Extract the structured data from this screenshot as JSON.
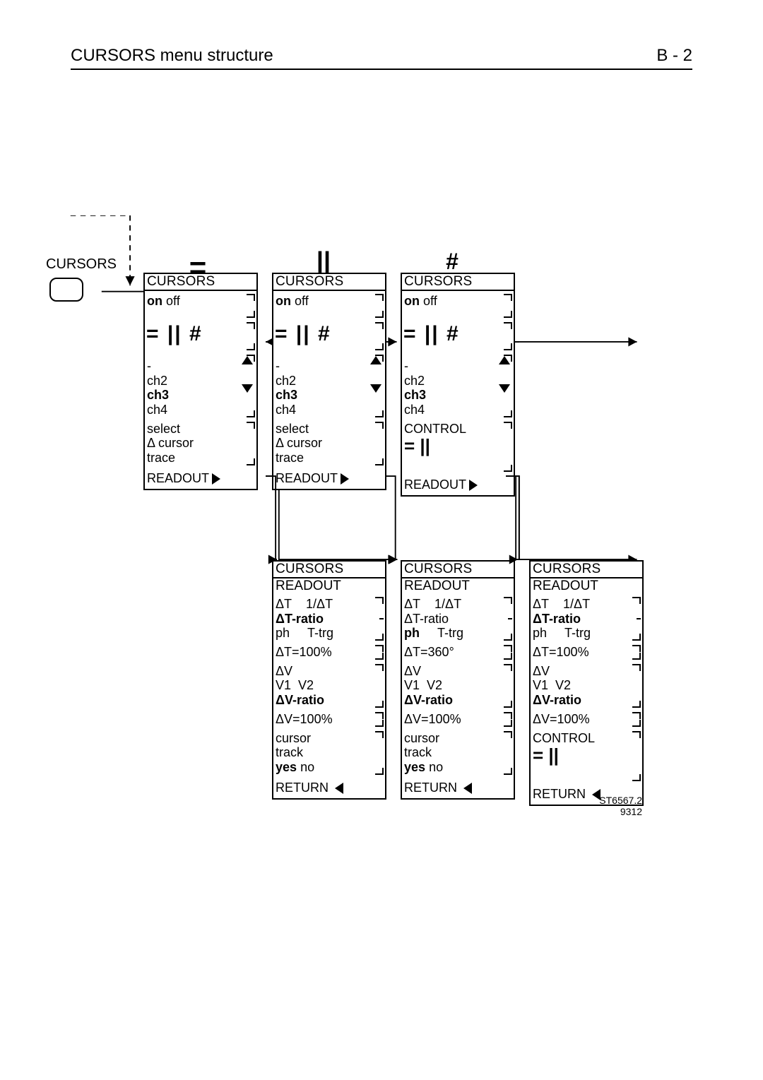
{
  "header": {
    "title": "CURSORS menu structure",
    "page": "B - 2"
  },
  "diagram_root": "CURSORS",
  "mode_symbols": {
    "equal": "=",
    "vertical": "||",
    "hash": "#"
  },
  "menu": {
    "title": "CURSORS",
    "onoff": {
      "on": "on",
      "off": "off"
    },
    "modes_row": "= || #",
    "ch_dash": "-",
    "ch2": "ch2",
    "ch3": "ch3",
    "ch4": "ch4",
    "select": "select",
    "delta_cursor": "Δ cursor",
    "trace": "trace",
    "readout": "READOUT",
    "control": "CONTROL",
    "control_symbol": "= ||"
  },
  "readout": {
    "title": "CURSORS",
    "subtitle": "READOUT",
    "dT": "ΔT",
    "inv_dT": "1/ΔT",
    "dT_ratio": "ΔT-ratio",
    "ph": "ph",
    "T_trg": "T-trg",
    "dT_100": "ΔT=100%",
    "dT_360": "ΔT=360°",
    "dV": "ΔV",
    "V1V2": "V1  V2",
    "dV_ratio": "ΔV-ratio",
    "dV_100": "ΔV=100%",
    "cursor": "cursor",
    "track": "track",
    "yes": "yes",
    "no": "no",
    "control": "CONTROL",
    "control_symbol": "= ||",
    "return": "RETURN"
  },
  "doc_id": {
    "ref": "ST6567.2",
    "date": "9312"
  }
}
